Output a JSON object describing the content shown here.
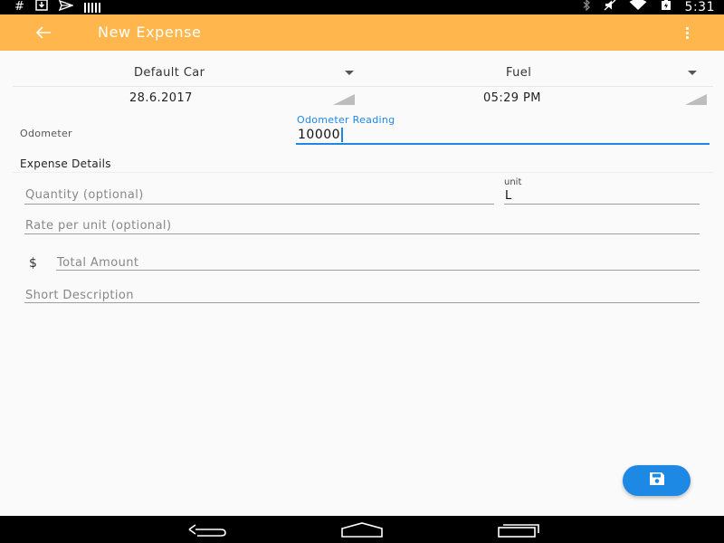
{
  "statusbar": {
    "left_icons": [
      "hash-icon",
      "download-icon",
      "send-icon",
      "signal-bars-icon"
    ],
    "hash_glyph": "#",
    "right_icons": [
      "bluetooth-icon",
      "mute-icon",
      "wifi-icon",
      "battery-icon"
    ],
    "time": "5:31"
  },
  "appbar": {
    "title": "New Expense",
    "back_icon": "arrow-back-icon",
    "menu_icon": "overflow-menu-icon",
    "background": "#ffb74d"
  },
  "selectors": {
    "vehicle": "Default Car",
    "category": "Fuel"
  },
  "datetime": {
    "date": "28.6.2017",
    "time": "05:29 PM"
  },
  "odometer": {
    "label": "Odometer",
    "hint": "Odometer Reading",
    "value": "10000"
  },
  "expense_details": {
    "section_title": "Expense Details",
    "quantity_placeholder": "Quantity (optional)",
    "unit_label": "unit",
    "unit_value": "L",
    "rate_placeholder": "Rate per unit (optional)",
    "currency_symbol": "$",
    "total_placeholder": "Total Amount",
    "description_placeholder": "Short Description"
  },
  "fab": {
    "icon": "save-icon",
    "color": "#1e88e5"
  },
  "navbar": {
    "icons": [
      "nav-back-icon",
      "nav-home-icon",
      "nav-recents-icon"
    ]
  }
}
